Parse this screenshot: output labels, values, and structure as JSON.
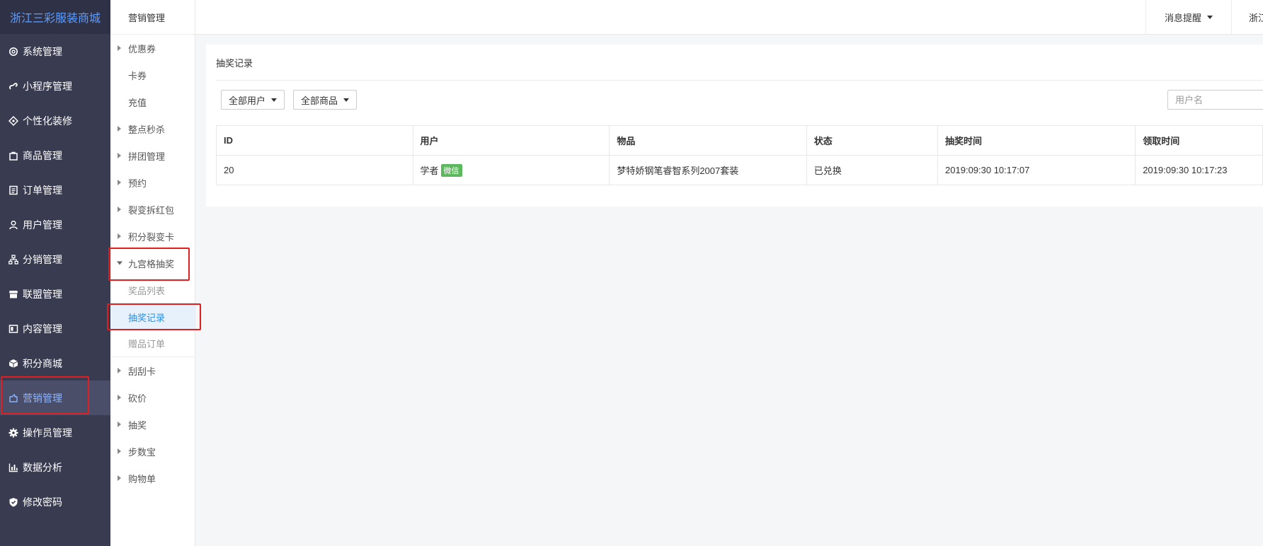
{
  "brand": "浙江三彩服装商城",
  "nav": [
    {
      "label": "系统管理",
      "icon": "settings-outline-icon"
    },
    {
      "label": "小程序管理",
      "icon": "mini-program-icon"
    },
    {
      "label": "个性化装修",
      "icon": "decorate-icon"
    },
    {
      "label": "商品管理",
      "icon": "shopping-bag-icon"
    },
    {
      "label": "订单管理",
      "icon": "order-list-icon"
    },
    {
      "label": "用户管理",
      "icon": "user-icon"
    },
    {
      "label": "分销管理",
      "icon": "hierarchy-icon"
    },
    {
      "label": "联盟管理",
      "icon": "store-icon"
    },
    {
      "label": "内容管理",
      "icon": "content-icon"
    },
    {
      "label": "积分商城",
      "icon": "cube-icon"
    },
    {
      "label": "营销管理",
      "icon": "marketing-icon"
    },
    {
      "label": "操作员管理",
      "icon": "gear-icon"
    },
    {
      "label": "数据分析",
      "icon": "bar-chart-icon"
    },
    {
      "label": "修改密码",
      "icon": "shield-check-icon"
    }
  ],
  "colors": {
    "sidebar_bg": "#393c51",
    "brand_text": "#5c9dff",
    "active_text": "#8db4ff",
    "highlight_box": "#e02020",
    "wechat_badge": "#5cb85c",
    "selected_sub_text": "#2f8ee5"
  },
  "subnav": {
    "title": "营销管理",
    "items": [
      {
        "label": "优惠券",
        "arrow": "right"
      },
      {
        "label": "卡券",
        "arrow": ""
      },
      {
        "label": "充值",
        "arrow": ""
      },
      {
        "label": "整点秒杀",
        "arrow": "right"
      },
      {
        "label": "拼团管理",
        "arrow": "right"
      },
      {
        "label": "预约",
        "arrow": "right"
      },
      {
        "label": "裂变拆红包",
        "arrow": "right"
      },
      {
        "label": "积分裂变卡",
        "arrow": "right"
      },
      {
        "label": "九宫格抽奖",
        "arrow": "down"
      },
      {
        "label": "奖品列表",
        "arrow": "",
        "child": true
      },
      {
        "label": "抽奖记录",
        "arrow": "",
        "child": true,
        "selected": true
      },
      {
        "label": "赠品订单",
        "arrow": "",
        "child": true
      },
      {
        "label": "刮刮卡",
        "arrow": "right"
      },
      {
        "label": "砍价",
        "arrow": "right"
      },
      {
        "label": "抽奖",
        "arrow": "right"
      },
      {
        "label": "步数宝",
        "arrow": "right"
      },
      {
        "label": "购物单",
        "arrow": "right"
      }
    ]
  },
  "topbar": {
    "messages": "消息提醒",
    "shop": "浙江"
  },
  "main": {
    "title": "抽奖记录",
    "filters": {
      "user": "全部用户",
      "goods": "全部商品"
    },
    "search_placeholder": "用户名",
    "table": {
      "headers": [
        "ID",
        "用户",
        "物品",
        "状态",
        "抽奖时间",
        "领取时间"
      ],
      "rows": [
        {
          "id": "20",
          "user": "学者",
          "badge": "微信",
          "item": "梦特娇钢笔睿智系列2007套装",
          "status": "已兑换",
          "draw_time": "2019:09:30 10:17:07",
          "claim_time": "2019:09:30 10:17:23"
        }
      ]
    }
  }
}
